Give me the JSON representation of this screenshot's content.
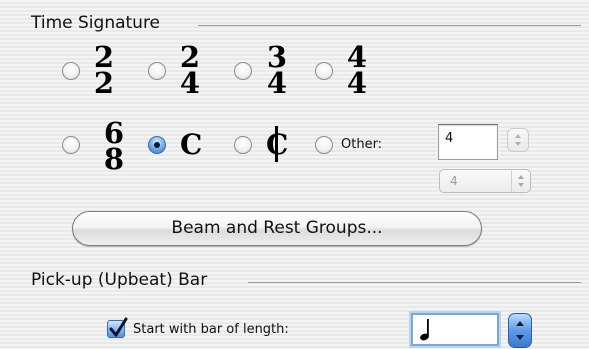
{
  "time_signature": {
    "title": "Time Signature",
    "options": [
      {
        "top": "2",
        "bottom": "2"
      },
      {
        "top": "2",
        "bottom": "4"
      },
      {
        "top": "3",
        "bottom": "4"
      },
      {
        "top": "4",
        "bottom": "4"
      },
      {
        "top": "6",
        "bottom": "8"
      }
    ],
    "common_time_symbol": "C",
    "cut_time_symbol": "C",
    "selected": "common-time",
    "other_label": "Other:",
    "other_numerator_value": "4",
    "other_denominator_value": "4",
    "beam_button_label": "Beam and Rest Groups..."
  },
  "pickup": {
    "title": "Pick-up (Upbeat) Bar",
    "checkbox_label": "Start with bar of length:",
    "checked": true,
    "note_value_icon": "quarter-note-icon"
  },
  "colors": {
    "accent": "#3b79cf",
    "divider": "#9a9a9a"
  }
}
